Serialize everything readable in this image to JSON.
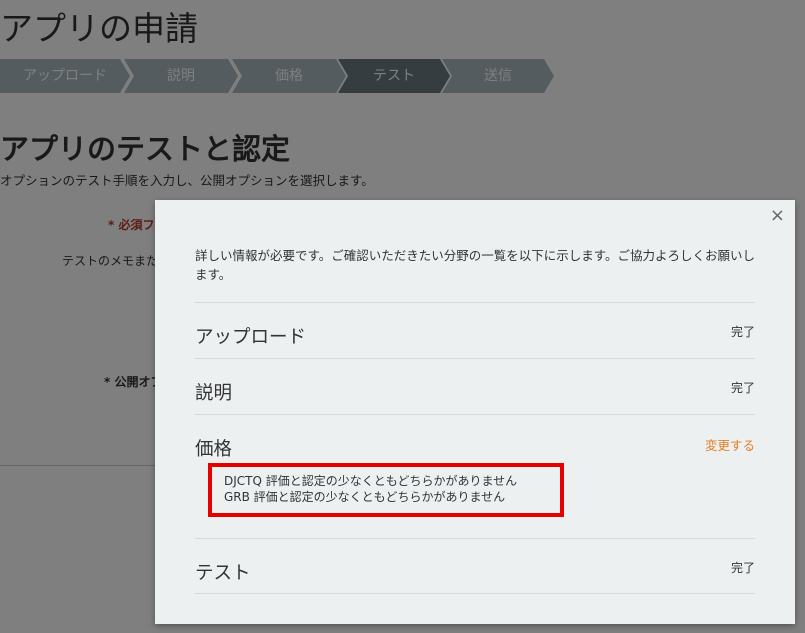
{
  "page": {
    "title": "アプリの申請",
    "steps": [
      "アップロード",
      "説明",
      "価格",
      "テスト",
      "送信"
    ],
    "active_step": "テスト",
    "section_title": "アプリのテストと認定",
    "section_desc": "オプションのテスト手順を入力し、公開オプションを選択します。",
    "required_label": "* 必須フ",
    "test_notes_label": "テストのメモまた",
    "publish_label": "* 公開オプ"
  },
  "modal": {
    "close_label": "×",
    "intro": "詳しい情報が必要です。ご確認いただきたい分野の一覧を以下に示します。ご協力よろしくお願いします。",
    "rows": [
      {
        "label": "アップロード",
        "status": "完了"
      },
      {
        "label": "説明",
        "status": "完了"
      },
      {
        "label": "価格",
        "status": "変更する",
        "errors": [
          "DJCTQ 評価と認定の少なくともどちらかがありません",
          "GRB 評価と認定の少なくともどちらかがありません"
        ]
      },
      {
        "label": "テスト",
        "status": "完了"
      }
    ]
  },
  "colors": {
    "step_inactive": "#a9b9bf",
    "step_active": "#6b7b82",
    "link": "#e67e22",
    "error_highlight": "#e60000"
  }
}
